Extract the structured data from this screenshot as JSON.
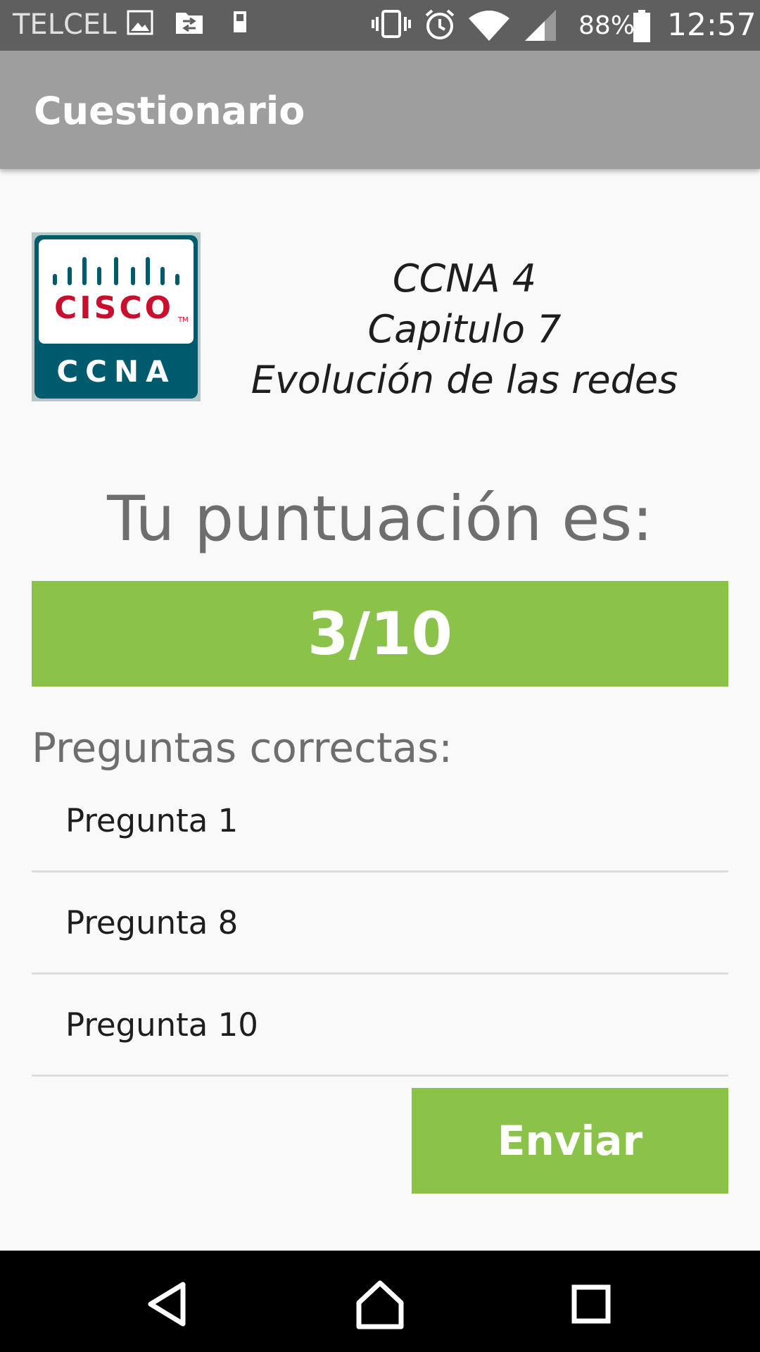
{
  "status_bar": {
    "carrier": "TELCEL",
    "battery_percent": "88%",
    "time": "12:57",
    "icons": [
      "image-icon",
      "file-transfer-icon",
      "device-icon",
      "vibrate-icon",
      "alarm-icon",
      "wifi-icon",
      "signal-icon",
      "battery-icon"
    ]
  },
  "app_bar": {
    "title": "Cuestionario"
  },
  "logo": {
    "brand": "CISCO",
    "tm": "TM",
    "product": "CCNA"
  },
  "header": {
    "line1": "CCNA 4",
    "line2": "Capitulo 7",
    "line3": "Evolución de las redes"
  },
  "score": {
    "label": "Tu puntuación es:",
    "value": "3/10",
    "correct": 3,
    "total": 10
  },
  "correct_questions": {
    "label": "Preguntas correctas:",
    "items": [
      "Pregunta 1",
      "Pregunta 8",
      "Pregunta 10"
    ]
  },
  "send_button": {
    "label": "Enviar"
  },
  "nav_bar": {
    "icons": [
      "back-icon",
      "home-icon",
      "recents-icon"
    ]
  },
  "colors": {
    "accent": "#8bc34a",
    "app_bar": "#9e9e9e",
    "status_bar": "#5f5f5f",
    "logo_teal": "#005a6e",
    "logo_red": "#c8102e"
  }
}
